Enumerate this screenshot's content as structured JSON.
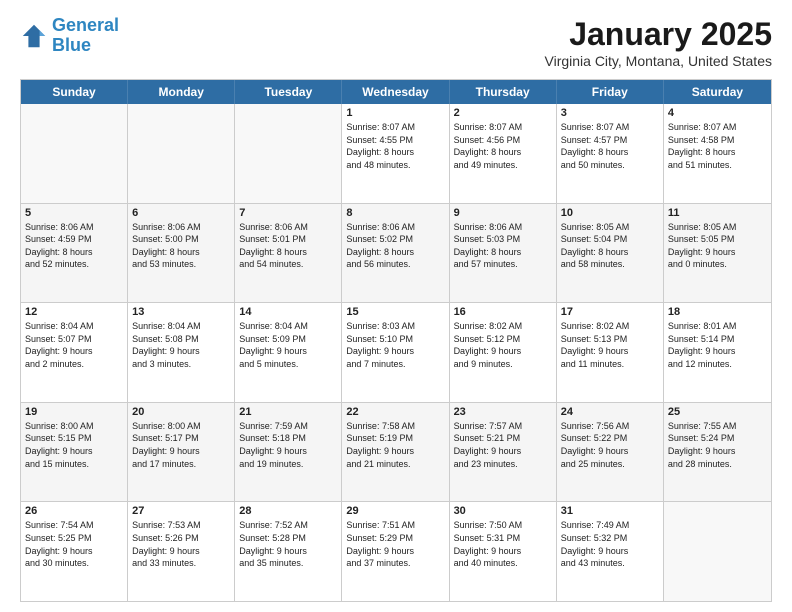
{
  "header": {
    "logo_line1": "General",
    "logo_line2": "Blue",
    "month_title": "January 2025",
    "subtitle": "Virginia City, Montana, United States"
  },
  "weekdays": [
    "Sunday",
    "Monday",
    "Tuesday",
    "Wednesday",
    "Thursday",
    "Friday",
    "Saturday"
  ],
  "rows": [
    [
      {
        "day": "",
        "info": ""
      },
      {
        "day": "",
        "info": ""
      },
      {
        "day": "",
        "info": ""
      },
      {
        "day": "1",
        "info": "Sunrise: 8:07 AM\nSunset: 4:55 PM\nDaylight: 8 hours\nand 48 minutes."
      },
      {
        "day": "2",
        "info": "Sunrise: 8:07 AM\nSunset: 4:56 PM\nDaylight: 8 hours\nand 49 minutes."
      },
      {
        "day": "3",
        "info": "Sunrise: 8:07 AM\nSunset: 4:57 PM\nDaylight: 8 hours\nand 50 minutes."
      },
      {
        "day": "4",
        "info": "Sunrise: 8:07 AM\nSunset: 4:58 PM\nDaylight: 8 hours\nand 51 minutes."
      }
    ],
    [
      {
        "day": "5",
        "info": "Sunrise: 8:06 AM\nSunset: 4:59 PM\nDaylight: 8 hours\nand 52 minutes."
      },
      {
        "day": "6",
        "info": "Sunrise: 8:06 AM\nSunset: 5:00 PM\nDaylight: 8 hours\nand 53 minutes."
      },
      {
        "day": "7",
        "info": "Sunrise: 8:06 AM\nSunset: 5:01 PM\nDaylight: 8 hours\nand 54 minutes."
      },
      {
        "day": "8",
        "info": "Sunrise: 8:06 AM\nSunset: 5:02 PM\nDaylight: 8 hours\nand 56 minutes."
      },
      {
        "day": "9",
        "info": "Sunrise: 8:06 AM\nSunset: 5:03 PM\nDaylight: 8 hours\nand 57 minutes."
      },
      {
        "day": "10",
        "info": "Sunrise: 8:05 AM\nSunset: 5:04 PM\nDaylight: 8 hours\nand 58 minutes."
      },
      {
        "day": "11",
        "info": "Sunrise: 8:05 AM\nSunset: 5:05 PM\nDaylight: 9 hours\nand 0 minutes."
      }
    ],
    [
      {
        "day": "12",
        "info": "Sunrise: 8:04 AM\nSunset: 5:07 PM\nDaylight: 9 hours\nand 2 minutes."
      },
      {
        "day": "13",
        "info": "Sunrise: 8:04 AM\nSunset: 5:08 PM\nDaylight: 9 hours\nand 3 minutes."
      },
      {
        "day": "14",
        "info": "Sunrise: 8:04 AM\nSunset: 5:09 PM\nDaylight: 9 hours\nand 5 minutes."
      },
      {
        "day": "15",
        "info": "Sunrise: 8:03 AM\nSunset: 5:10 PM\nDaylight: 9 hours\nand 7 minutes."
      },
      {
        "day": "16",
        "info": "Sunrise: 8:02 AM\nSunset: 5:12 PM\nDaylight: 9 hours\nand 9 minutes."
      },
      {
        "day": "17",
        "info": "Sunrise: 8:02 AM\nSunset: 5:13 PM\nDaylight: 9 hours\nand 11 minutes."
      },
      {
        "day": "18",
        "info": "Sunrise: 8:01 AM\nSunset: 5:14 PM\nDaylight: 9 hours\nand 12 minutes."
      }
    ],
    [
      {
        "day": "19",
        "info": "Sunrise: 8:00 AM\nSunset: 5:15 PM\nDaylight: 9 hours\nand 15 minutes."
      },
      {
        "day": "20",
        "info": "Sunrise: 8:00 AM\nSunset: 5:17 PM\nDaylight: 9 hours\nand 17 minutes."
      },
      {
        "day": "21",
        "info": "Sunrise: 7:59 AM\nSunset: 5:18 PM\nDaylight: 9 hours\nand 19 minutes."
      },
      {
        "day": "22",
        "info": "Sunrise: 7:58 AM\nSunset: 5:19 PM\nDaylight: 9 hours\nand 21 minutes."
      },
      {
        "day": "23",
        "info": "Sunrise: 7:57 AM\nSunset: 5:21 PM\nDaylight: 9 hours\nand 23 minutes."
      },
      {
        "day": "24",
        "info": "Sunrise: 7:56 AM\nSunset: 5:22 PM\nDaylight: 9 hours\nand 25 minutes."
      },
      {
        "day": "25",
        "info": "Sunrise: 7:55 AM\nSunset: 5:24 PM\nDaylight: 9 hours\nand 28 minutes."
      }
    ],
    [
      {
        "day": "26",
        "info": "Sunrise: 7:54 AM\nSunset: 5:25 PM\nDaylight: 9 hours\nand 30 minutes."
      },
      {
        "day": "27",
        "info": "Sunrise: 7:53 AM\nSunset: 5:26 PM\nDaylight: 9 hours\nand 33 minutes."
      },
      {
        "day": "28",
        "info": "Sunrise: 7:52 AM\nSunset: 5:28 PM\nDaylight: 9 hours\nand 35 minutes."
      },
      {
        "day": "29",
        "info": "Sunrise: 7:51 AM\nSunset: 5:29 PM\nDaylight: 9 hours\nand 37 minutes."
      },
      {
        "day": "30",
        "info": "Sunrise: 7:50 AM\nSunset: 5:31 PM\nDaylight: 9 hours\nand 40 minutes."
      },
      {
        "day": "31",
        "info": "Sunrise: 7:49 AM\nSunset: 5:32 PM\nDaylight: 9 hours\nand 43 minutes."
      },
      {
        "day": "",
        "info": ""
      }
    ]
  ]
}
